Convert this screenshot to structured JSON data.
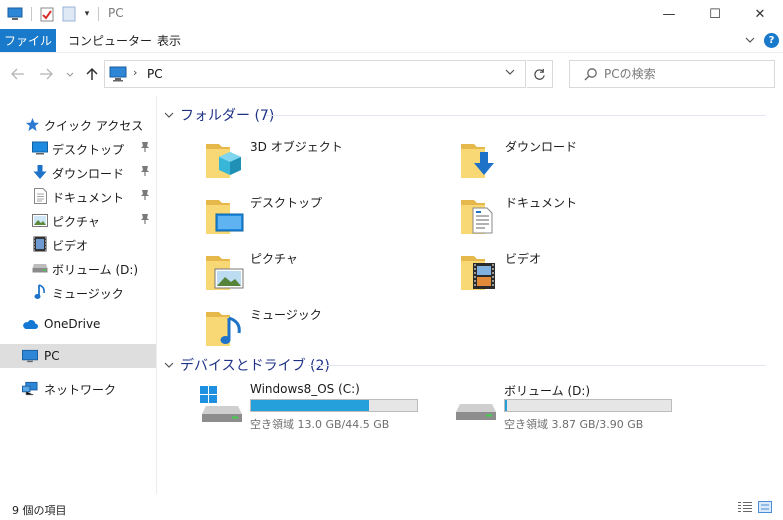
{
  "window": {
    "title": "PC",
    "minimize": "—",
    "maximize": "☐",
    "close": "✕"
  },
  "ribbon": {
    "tabs": [
      {
        "label": "ファイル"
      },
      {
        "label": "コンピューター"
      },
      {
        "label": "表示"
      }
    ],
    "expand_icon": "chevron-down-icon",
    "help_label": "?"
  },
  "nav": {
    "address_path": "PC",
    "address_sep": "›",
    "search_placeholder": "PCの検索"
  },
  "sidebar": {
    "items": [
      {
        "label": "クイック アクセス",
        "icon": "quick-access-star-icon"
      },
      {
        "label": "デスクトップ",
        "icon": "desktop-icon",
        "pinned": true
      },
      {
        "label": "ダウンロード",
        "icon": "download-icon",
        "pinned": true
      },
      {
        "label": "ドキュメント",
        "icon": "document-icon",
        "pinned": true
      },
      {
        "label": "ピクチャ",
        "icon": "pictures-icon",
        "pinned": true
      },
      {
        "label": "ビデオ",
        "icon": "video-icon"
      },
      {
        "label": "ボリューム (D:)",
        "icon": "drive-icon"
      },
      {
        "label": "ミュージック",
        "icon": "music-icon"
      },
      {
        "label": "OneDrive",
        "icon": "cloud-icon"
      },
      {
        "label": "PC",
        "icon": "pc-icon",
        "selected": true
      },
      {
        "label": "ネットワーク",
        "icon": "network-icon"
      }
    ]
  },
  "main": {
    "folders_header": "フォルダー (7)",
    "folders": [
      {
        "label": "3D オブジェクト",
        "icon": "3d-objects-folder-icon"
      },
      {
        "label": "ダウンロード",
        "icon": "downloads-folder-icon"
      },
      {
        "label": "デスクトップ",
        "icon": "desktop-folder-icon"
      },
      {
        "label": "ドキュメント",
        "icon": "documents-folder-icon"
      },
      {
        "label": "ピクチャ",
        "icon": "pictures-folder-icon"
      },
      {
        "label": "ビデオ",
        "icon": "videos-folder-icon"
      },
      {
        "label": "ミュージック",
        "icon": "music-folder-icon"
      }
    ],
    "drives_header": "デバイスとドライブ (2)",
    "drives": [
      {
        "name": "Windows8_OS (C:)",
        "info": "空き領域 13.0 GB/44.5 GB",
        "used_fraction": 0.71,
        "icon": "windows-drive-icon"
      },
      {
        "name": "ボリューム (D:)",
        "info": "空き領域 3.87 GB/3.90 GB",
        "used_fraction": 0.01,
        "icon": "drive-icon"
      }
    ]
  },
  "status": {
    "item_count": "9 個の項目"
  },
  "colors": {
    "accent": "#1979ca",
    "folder": "#f8d775",
    "progress": "#26a0da",
    "group_header": "#1e3287",
    "selection": "#dedede"
  }
}
